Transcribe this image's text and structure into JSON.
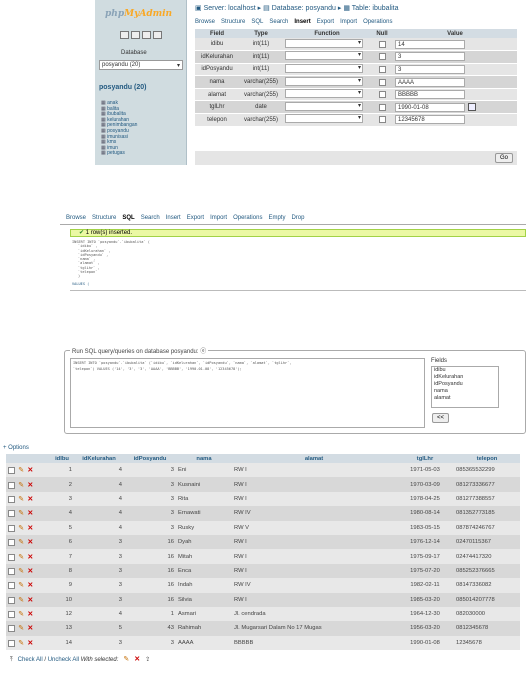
{
  "panel1": {
    "logo_prefix": "php",
    "logo_accent": "MyAdmin",
    "db_label": "Database",
    "db_selected": "posyandu (20)",
    "db_heading": "posyandu (20)",
    "tables": [
      "anak",
      "balita",
      "ibubalita",
      "kelurahan",
      "penimbangan",
      "posyandu",
      "imunisasi",
      "kms",
      "imun",
      "petugas"
    ],
    "breadcrumb": [
      "Server: localhost",
      "Database: posyandu",
      "Table: ibubalita"
    ],
    "tabs": [
      "Browse",
      "Structure",
      "SQL",
      "Search",
      "Insert",
      "Export",
      "Import",
      "Operations"
    ],
    "active_tab": "Insert",
    "headers": [
      "Field",
      "Type",
      "Function",
      "Null",
      "Value"
    ],
    "rows": [
      {
        "field": "idibu",
        "type": "int(11)",
        "value": "14"
      },
      {
        "field": "idKelurahan",
        "type": "int(11)",
        "value": "3"
      },
      {
        "field": "idPosyandu",
        "type": "int(11)",
        "value": "3"
      },
      {
        "field": "nama",
        "type": "varchar(255)",
        "value": "AAAA"
      },
      {
        "field": "alamat",
        "type": "varchar(255)",
        "value": "BBBBB"
      },
      {
        "field": "tglLhr",
        "type": "date",
        "value": "1990-01-08"
      },
      {
        "field": "telepon",
        "type": "varchar(255)",
        "value": "12345678"
      }
    ],
    "go": "Go"
  },
  "panel2": {
    "tabs": [
      "Browse",
      "Structure",
      "SQL",
      "Search",
      "Insert",
      "Export",
      "Import",
      "Operations",
      "Empty",
      "Drop"
    ],
    "active_tab": "SQL",
    "success": "1 row(s) inserted.",
    "query_lines": [
      "INSERT INTO `posyandu`.`ibubalita` (",
      "`idibu` ,",
      "`idKelurahan` ,",
      "`idPosyandu` ,",
      "`nama` ,",
      "`alamat` ,",
      "`tglLhr` ,",
      "`telepon`",
      ")"
    ],
    "values_label": "VALUES (",
    "sql_legend": "Run SQL query/queries on database posyandu:",
    "sql_text_1": "INSERT INTO `posyandu`.`ibubalita` (`idibu`, `idKelurahan`, `idPosyandu`, `nama`, `alamat`, `tglLhr`,",
    "sql_text_2": "`telepon`) VALUES ('14', '3', '3', 'AAAA', 'BBBBB', '1990-01-08', '12345678');",
    "fields_label": "Fields",
    "fields": [
      "idibu",
      "idKelurahan",
      "idPosyandu",
      "nama",
      "alamat"
    ],
    "insert_btn": "<<"
  },
  "panel3": {
    "options": "+ Options",
    "columns": [
      "idIbu",
      "idKelurahan",
      "idPosyandu",
      "nama",
      "alamat",
      "tglLhr",
      "telepon"
    ],
    "rows": [
      [
        "1",
        "4",
        "3",
        "Eni",
        "RW I",
        "1971-05-03",
        "085365532299"
      ],
      [
        "2",
        "4",
        "3",
        "Kusnaini",
        "RW I",
        "1970-03-09",
        "081273336677"
      ],
      [
        "3",
        "4",
        "3",
        "Rita",
        "RW I",
        "1978-04-25",
        "081277388557"
      ],
      [
        "4",
        "4",
        "3",
        "Ernawati",
        "RW IV",
        "1980-08-14",
        "081352773185"
      ],
      [
        "5",
        "4",
        "3",
        "Rusky",
        "RW V",
        "1983-05-15",
        "087874246767"
      ],
      [
        "6",
        "3",
        "16",
        "Dyah",
        "RW I",
        "1976-12-14",
        "02470115367"
      ],
      [
        "7",
        "3",
        "16",
        "Mitah",
        "RW I",
        "1975-09-17",
        "02474417320"
      ],
      [
        "8",
        "3",
        "16",
        "Enca",
        "RW I",
        "1975-07-20",
        "085252376665"
      ],
      [
        "9",
        "3",
        "16",
        "Indah",
        "RW IV",
        "1982-02-11",
        "08147336082"
      ],
      [
        "10",
        "3",
        "16",
        "Silvia",
        "RW I",
        "1985-03-20",
        "085014207778"
      ],
      [
        "12",
        "4",
        "1",
        "Asmari",
        "Jl. cendrada",
        "1964-12-30",
        "082030000"
      ],
      [
        "13",
        "5",
        "43",
        "Rahimah",
        "Jl. Mugarsari Dalam No 17 Mugas",
        "1956-03-20",
        "0812345678"
      ],
      [
        "14",
        "3",
        "3",
        "AAAA",
        "BBBBB",
        "1990-01-08",
        "12345678"
      ]
    ],
    "check_all": "Check All",
    "uncheck_all": "Uncheck All",
    "with_selected": "With selected:"
  }
}
